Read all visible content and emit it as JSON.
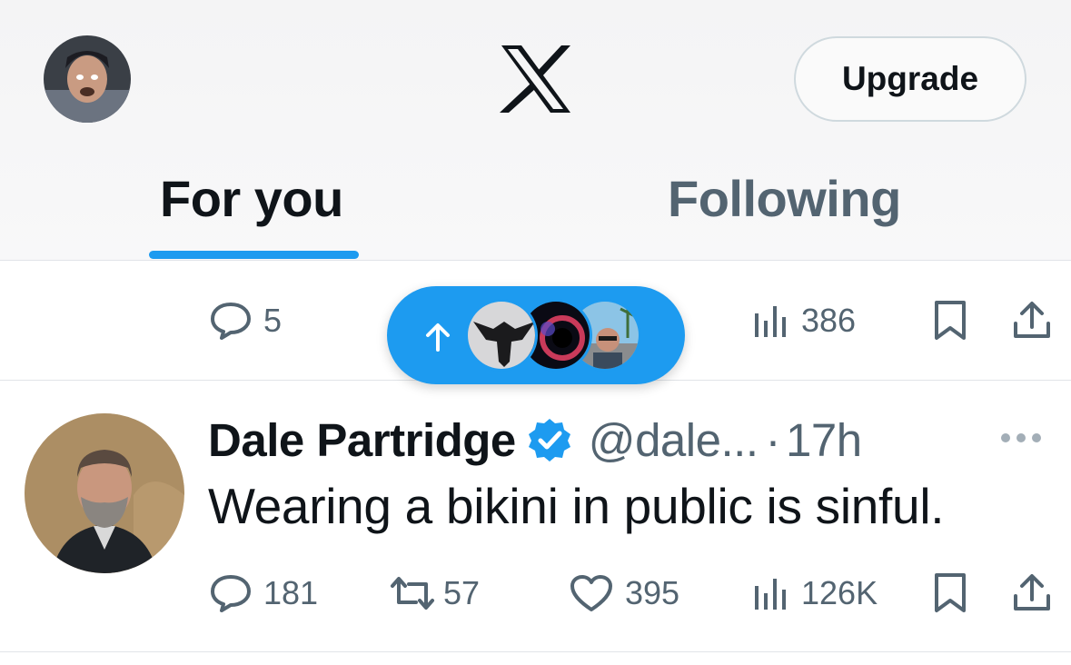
{
  "header": {
    "logo_icon": "x-logo",
    "upgrade_label": "Upgrade",
    "tabs": [
      {
        "label": "For you",
        "active": true
      },
      {
        "label": "Following",
        "active": false
      }
    ]
  },
  "prev_tweet_actions": {
    "replies": "5",
    "views": "386"
  },
  "new_posts_pill": {
    "icon": "arrow-up-icon",
    "avatars": [
      "eagle-avatar",
      "galaxy-avatar",
      "beach-avatar"
    ]
  },
  "tweet": {
    "author_name": "Dale Partridge",
    "verified": true,
    "handle": "@dale...",
    "separator": "·",
    "time": "17h",
    "text": "Wearing a bikini in public is sinful.",
    "replies": "181",
    "reposts": "57",
    "likes": "395",
    "views": "126K"
  },
  "colors": {
    "accent": "#1d9bf0",
    "text_primary": "#0f1419",
    "text_secondary": "#536471"
  }
}
